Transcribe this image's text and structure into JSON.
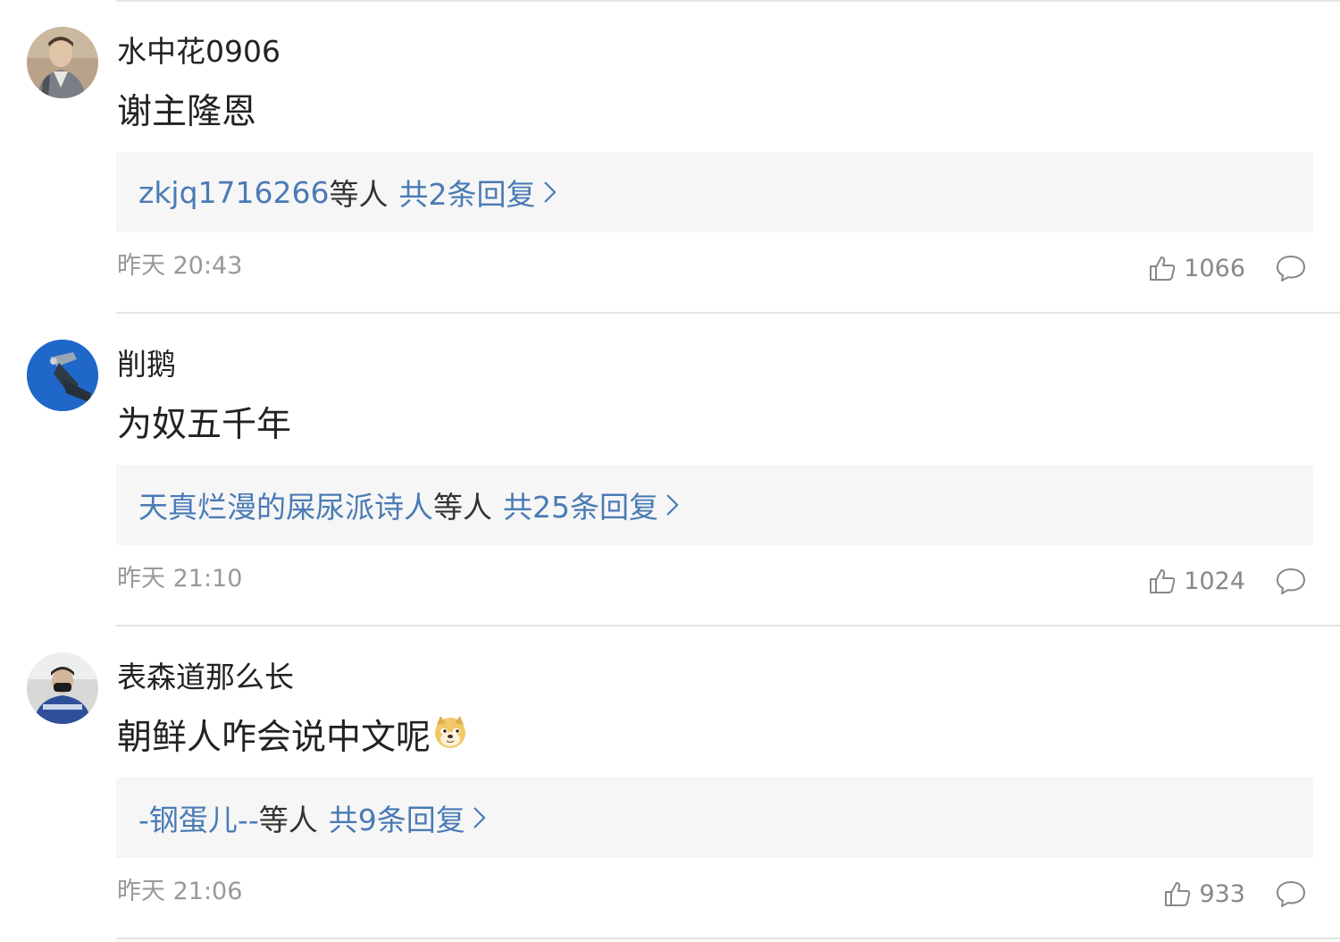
{
  "comments": [
    {
      "username": "水中花0906",
      "text": "谢主隆恩",
      "emoji": "",
      "reply_users": "zkjq1716266",
      "reply_etc": "等人",
      "reply_count": "共2条回复",
      "time": "昨天 20:43",
      "likes": "1066",
      "avatar": "avatar-photo-man-in-jacket"
    },
    {
      "username": "削鹅",
      "text": "为奴五千年",
      "emoji": "",
      "reply_users": "天真烂漫的屎尿派诗人",
      "reply_etc": "等人",
      "reply_count": "共25条回复",
      "time": "昨天 21:10",
      "likes": "1024",
      "avatar": "avatar-photo-blue-background"
    },
    {
      "username": "表森道那么长",
      "text": "朝鲜人咋会说中文呢",
      "emoji": "doge",
      "reply_users": "-钢蛋儿--",
      "reply_etc": "等人",
      "reply_count": "共9条回复",
      "time": "昨天 21:06",
      "likes": "933",
      "avatar": "avatar-photo-person-with-mask"
    }
  ],
  "colors": {
    "link_blue": "#4a7bb5",
    "meta_gray": "#999999",
    "reply_bg": "#f6f6f6",
    "divider": "#e5e5e5"
  }
}
